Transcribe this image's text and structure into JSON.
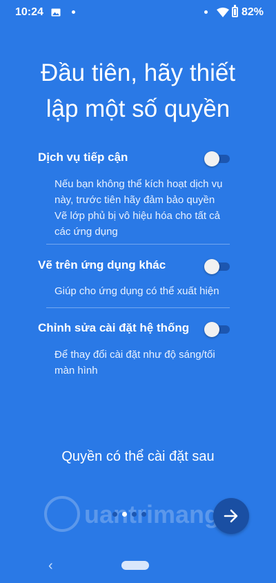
{
  "status_bar": {
    "time": "10:24",
    "battery_percent": "82%",
    "icons": [
      "image-icon",
      "dot-icon",
      "dot-icon",
      "wifi-icon",
      "battery-icon"
    ]
  },
  "title_line1": "Đầu tiên, hãy thiết",
  "title_line2": "lập một số quyền",
  "permissions": [
    {
      "title": "Dịch vụ tiếp cận",
      "desc_lines": [
        "Nếu bạn không thể kích hoạt dịch vụ",
        "này, trước tiên hãy đảm bảo quyền",
        "Vẽ lớp phủ bị vô hiệu hóa cho tất cả",
        "các ứng dụng"
      ],
      "enabled": false
    },
    {
      "title": "Vẽ trên ứng dụng khác",
      "desc_lines": [
        "Giúp cho ứng dụng có thể xuất hiện"
      ],
      "enabled": false
    },
    {
      "title": "Chỉnh sửa cài đặt hệ thống",
      "desc_lines": [
        "Để thay đổi cài đặt như độ sáng/tối",
        "màn hình"
      ],
      "enabled": false
    }
  ],
  "later_text": "Quyền có thể cài đặt sau",
  "pager": {
    "pages": 4,
    "current": 1
  },
  "watermark": "uantrimang",
  "next_button_icon": "arrow-right-icon",
  "navigation": {
    "back_icon": "chevron-left-icon",
    "home_icon": "home-pill-icon"
  },
  "colors": {
    "background": "#2a79e6",
    "toggle_track": "#1c56b0",
    "next_button": "#1a4fa3"
  }
}
